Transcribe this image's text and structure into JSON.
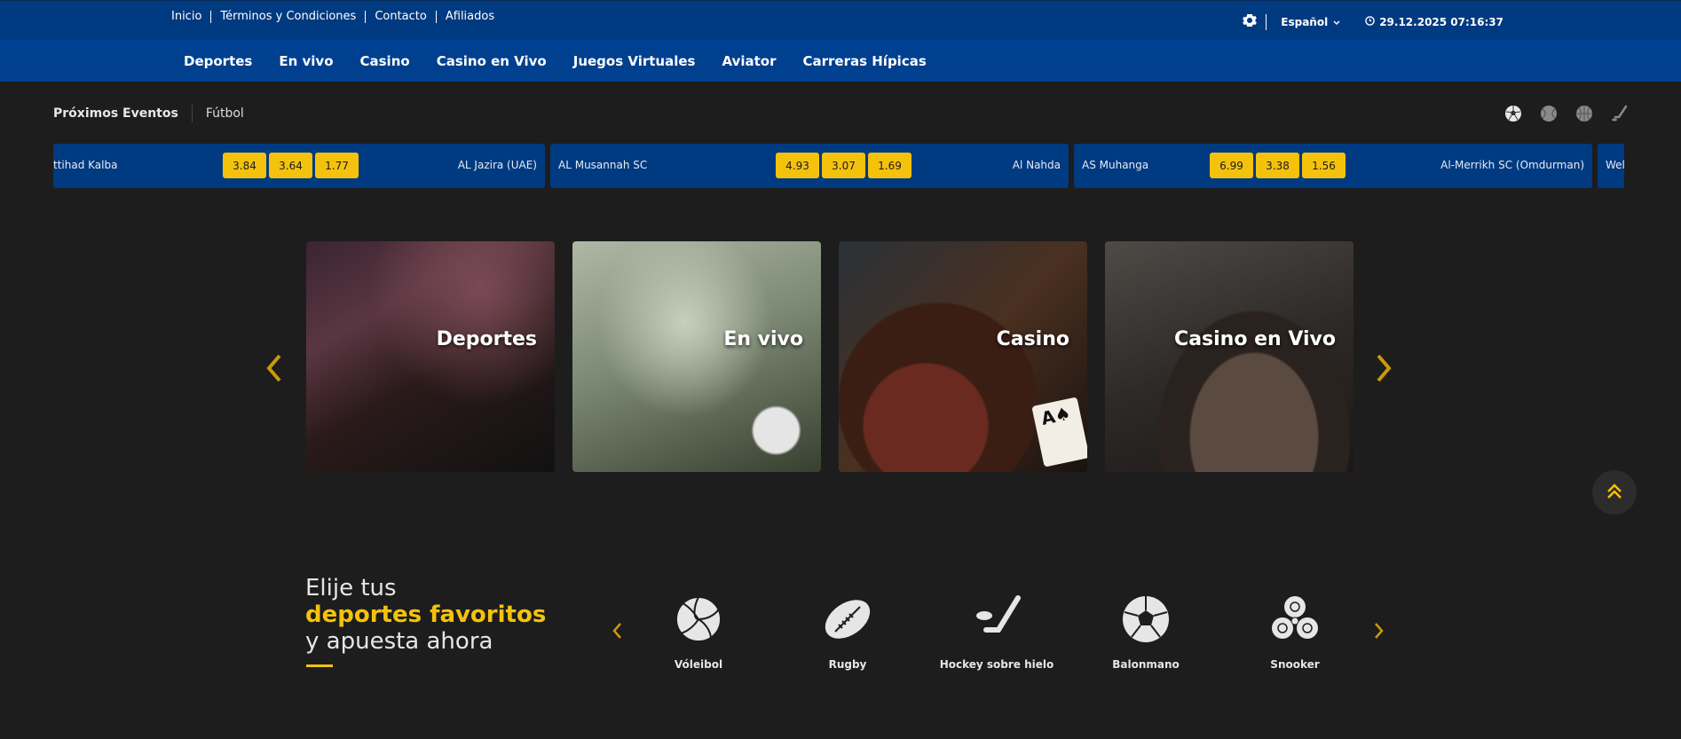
{
  "topbar": {
    "links": [
      "Inicio",
      "Términos y Condiciones",
      "Contacto",
      "Afiliados"
    ],
    "language": "Español",
    "datetime": "29.12.2025 07:16:37"
  },
  "nav": [
    "Deportes",
    "En vivo",
    "Casino",
    "Casino en Vivo",
    "Juegos Virtuales",
    "Aviator",
    "Carreras Hípicas"
  ],
  "events": {
    "title": "Próximos Eventos",
    "tab": "Fútbol",
    "sport_icons": [
      "soccer-icon",
      "tennis-icon",
      "basketball-icon",
      "hockey-icon"
    ],
    "matches": [
      {
        "home": "ttihad Kalba",
        "odds": [
          "3.84",
          "3.64",
          "1.77"
        ],
        "away": "AL Jazira (UAE)"
      },
      {
        "home": "AL Musannah SC",
        "odds": [
          "4.93",
          "3.07",
          "1.69"
        ],
        "away": "Al Nahda"
      },
      {
        "home": "AS Muhanga",
        "odds": [
          "6.99",
          "3.38",
          "1.56"
        ],
        "away": "Al-Merrikh SC (Omdurman)"
      },
      {
        "home": "Wel",
        "odds": [],
        "away": ""
      }
    ]
  },
  "cards": [
    "Deportes",
    "En vivo",
    "Casino",
    "Casino en Vivo"
  ],
  "favorites": {
    "line1": "Elije tus",
    "line2": "deportes favoritos",
    "line3": "y apuesta ahora",
    "sports": [
      "Vóleibol",
      "Rugby",
      "Hockey sobre hielo",
      "Balonmano",
      "Snooker"
    ]
  },
  "colors": {
    "accent": "#f4c20d",
    "header_blue": "#003a80",
    "background": "#1d1d1d"
  }
}
